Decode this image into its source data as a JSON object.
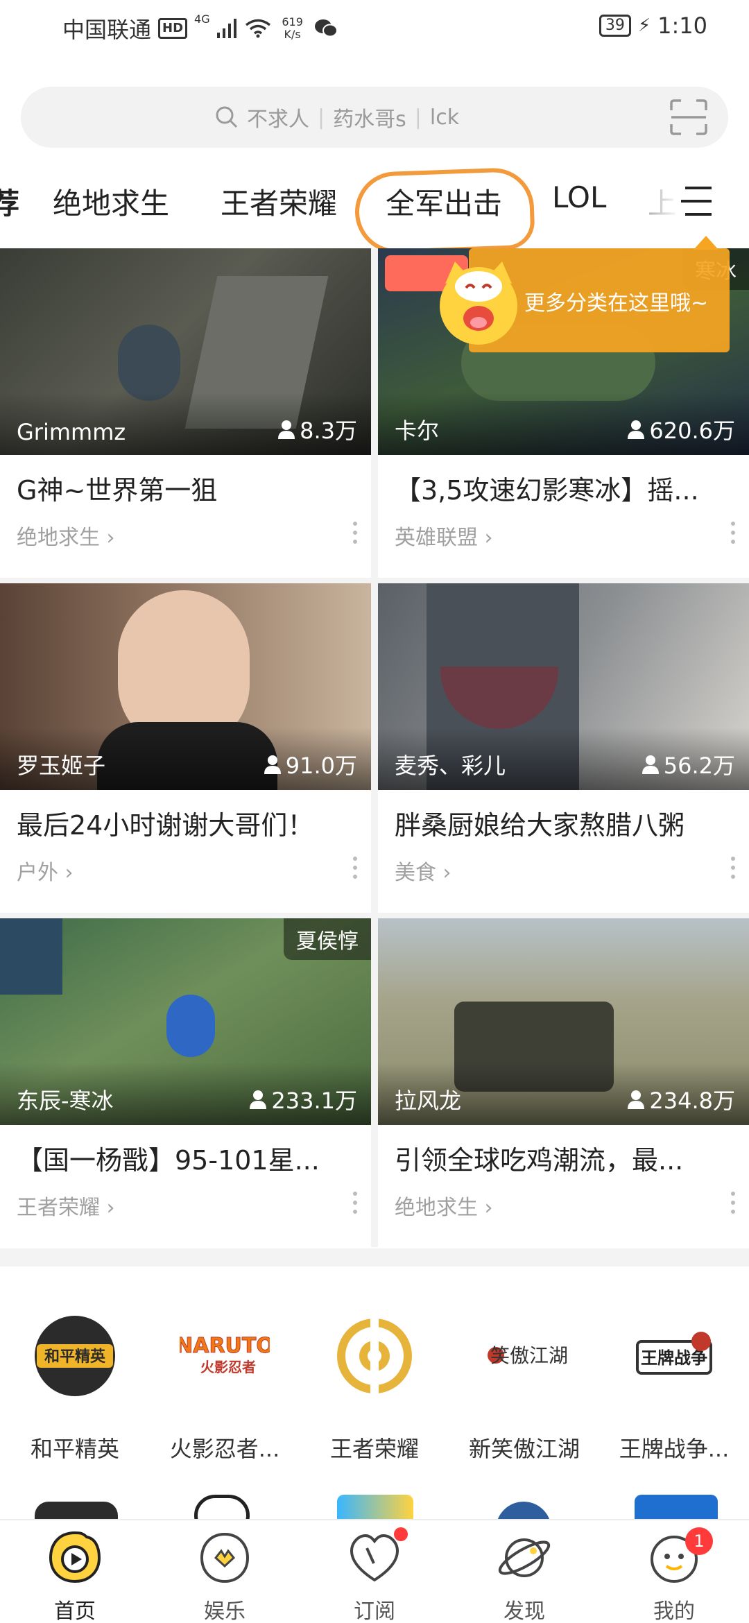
{
  "status_bar": {
    "carrier": "中国联通",
    "hd": "HD",
    "net_type": "4G",
    "net_speed_value": "619",
    "net_speed_unit": "K/s",
    "battery": "39",
    "time": "1:10"
  },
  "search": {
    "placeholder_1": "不求人",
    "placeholder_2": "药水哥s",
    "placeholder_3": "lck",
    "separator": "|"
  },
  "tabs": {
    "partial_left": "荐",
    "items": [
      "绝地求生",
      "王者荣耀",
      "全军出击",
      "LOL"
    ],
    "partial_right": "上"
  },
  "tooltip": {
    "text": "更多分类在这里哦~"
  },
  "cards": [
    {
      "streamer": "Grimmmz",
      "viewers": "8.3万",
      "title": "G神~世界第一狙",
      "category": "绝地求生 ›",
      "corner": ""
    },
    {
      "streamer": "卡尔",
      "viewers": "620.6万",
      "title": "【3,5攻速幻影寒冰】摇...",
      "category": "英雄联盟 ›",
      "corner": "寒冰"
    },
    {
      "streamer": "罗玉姬子",
      "viewers": "91.0万",
      "title": "最后24小时谢谢大哥们！",
      "category": "户外 ›",
      "corner": ""
    },
    {
      "streamer": "麦秀、彩儿",
      "viewers": "56.2万",
      "title": "胖桑厨娘给大家熬腊八粥",
      "category": "美食 ›",
      "corner": ""
    },
    {
      "streamer": "东辰-寒冰",
      "viewers": "233.1万",
      "title": "【国一杨戬】95-101星...",
      "category": "王者荣耀 ›",
      "corner": "夏侯惇"
    },
    {
      "streamer": "拉风龙",
      "viewers": "234.8万",
      "title": "引领全球吃鸡潮流，最...",
      "category": "绝地求生 ›",
      "corner": ""
    }
  ],
  "categories": [
    "和平精英",
    "火影忍者...",
    "王者荣耀",
    "新笑傲江湖",
    "王牌战争..."
  ],
  "bottom_nav": {
    "items": [
      "首页",
      "娱乐",
      "订阅",
      "发现",
      "我的"
    ],
    "badge": "1"
  },
  "colors": {
    "accent": "#f6a522",
    "highlight": "#f39a3c",
    "badge": "#ff3a3a"
  }
}
